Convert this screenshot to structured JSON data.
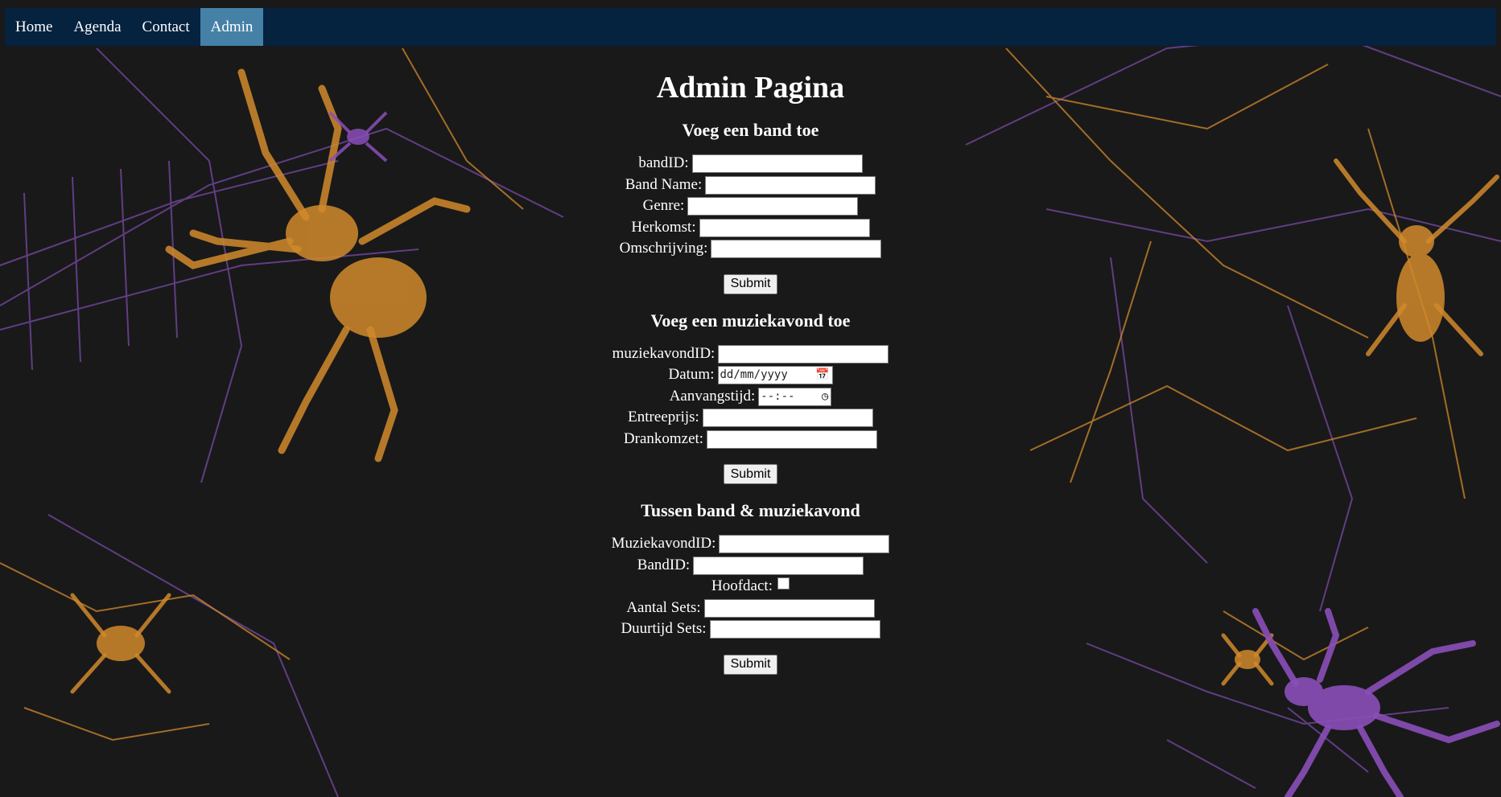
{
  "nav": {
    "items": [
      {
        "label": "Home",
        "active": false
      },
      {
        "label": "Agenda",
        "active": false
      },
      {
        "label": "Contact",
        "active": false
      },
      {
        "label": "Admin",
        "active": true
      }
    ],
    "active_color": "#4581a6",
    "bar_color": "#05223f"
  },
  "background": {
    "description_icon": "spider-web-background",
    "colors": [
      "#191919",
      "#d18a2c",
      "#7a4aa8"
    ]
  },
  "page": {
    "title": "Admin Pagina"
  },
  "band_form": {
    "heading": "Voeg een band toe",
    "fields": [
      {
        "label": "bandID:",
        "value": ""
      },
      {
        "label": "Band Name:",
        "value": ""
      },
      {
        "label": "Genre:",
        "value": ""
      },
      {
        "label": "Herkomst:",
        "value": ""
      },
      {
        "label": "Omschrijving:",
        "value": ""
      }
    ],
    "submit": "Submit"
  },
  "muziekavond_form": {
    "heading": "Voeg een muziekavond toe",
    "fields": {
      "id": {
        "label": "muziekavondID:",
        "value": ""
      },
      "datum": {
        "label": "Datum:",
        "placeholder": "dd/mm/yyyy"
      },
      "aanvangstijd": {
        "label": "Aanvangstijd:",
        "placeholder": "--:--"
      },
      "entreeprijs": {
        "label": "Entreeprijs:",
        "value": ""
      },
      "drankomzet": {
        "label": "Drankomzet:",
        "value": ""
      }
    },
    "submit": "Submit"
  },
  "tussen_form": {
    "heading": "Tussen band & muziekavond",
    "fields": {
      "muziekavondid": {
        "label": "MuziekavondID:",
        "value": ""
      },
      "bandid": {
        "label": "BandID:",
        "value": ""
      },
      "hoofdact": {
        "label": "Hoofdact:",
        "checked": false
      },
      "aantal_sets": {
        "label": "Aantal Sets:",
        "value": ""
      },
      "duurtijd_sets": {
        "label": "Duurtijd Sets:",
        "value": ""
      }
    },
    "submit": "Submit"
  }
}
